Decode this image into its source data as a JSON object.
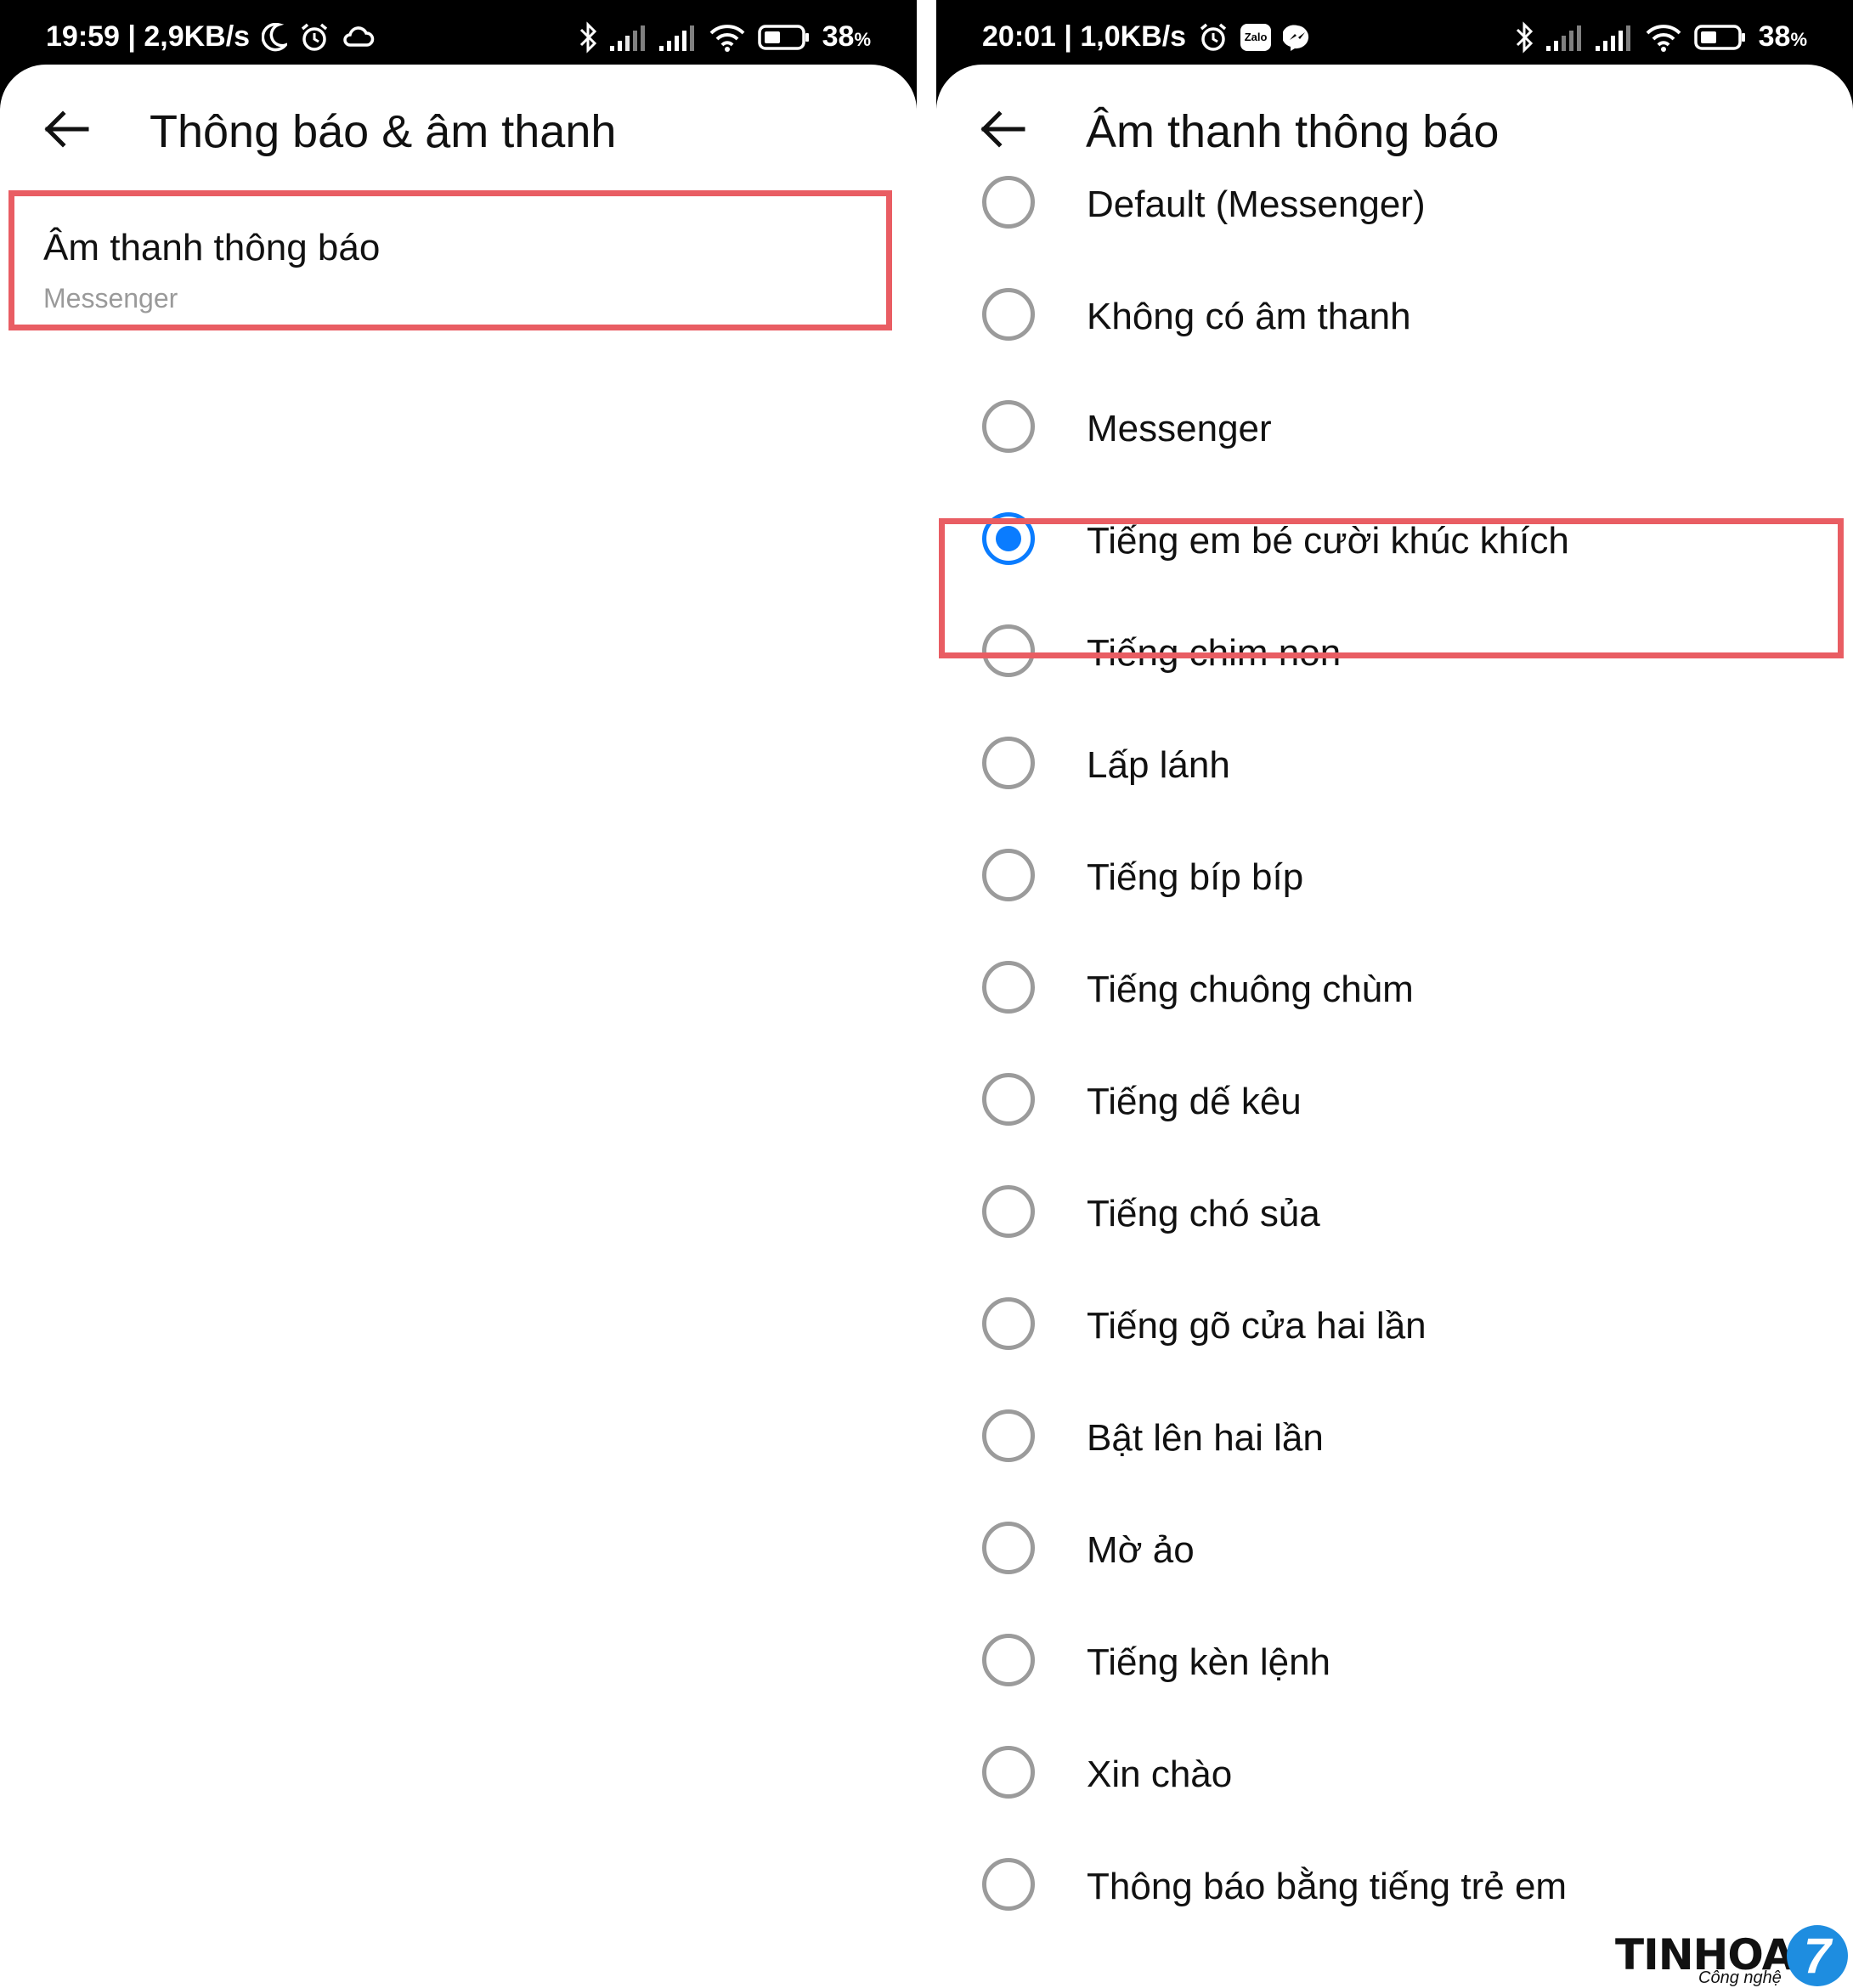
{
  "left": {
    "status": {
      "time_speed": "19:59 | 2,9KB/s",
      "battery": "38",
      "battery_unit": "%"
    },
    "title": "Thông báo & âm thanh",
    "item": {
      "title": "Âm thanh thông báo",
      "subtitle": "Messenger"
    }
  },
  "right": {
    "status": {
      "time_speed": "20:01 | 1,0KB/s",
      "zalo": "Zalo",
      "battery": "38",
      "battery_unit": "%"
    },
    "title": "Âm thanh thông báo",
    "options": [
      "Default (Messenger)",
      "Không có âm thanh",
      "Messenger",
      "Tiếng em bé cười khúc khích",
      "Tiếng chim non",
      "Lấp lánh",
      "Tiếng bíp bíp",
      "Tiếng chuông chùm",
      "Tiếng dế kêu",
      "Tiếng chó sủa",
      "Tiếng gõ cửa hai lần",
      "Bật lên hai lần",
      "Mờ ảo",
      "Tiếng kèn lệnh",
      "Xin chào",
      "Thông báo bằng tiếng trẻ em"
    ],
    "selected_option": "Tiếng em bé cười khúc khích"
  },
  "watermark": {
    "brand": "TINHOA",
    "number": "7",
    "sub": "Công nghệ"
  },
  "colors": {
    "accent": "#0a7cff",
    "highlight": "#e95d63",
    "radio_off": "#9b9b9b"
  }
}
